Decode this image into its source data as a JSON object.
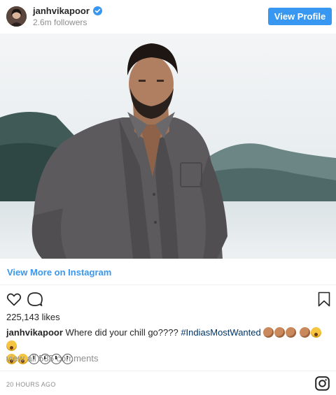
{
  "header": {
    "username": "janhvikapoor",
    "followers": "2.6m followers",
    "view_profile_label": "View Profile",
    "verified": true
  },
  "post": {
    "image_subject": "man-in-grey-shirt-by-lake",
    "view_more_label": "View More on Instagram",
    "likes": "225,143 likes",
    "caption_user": "janhvikapoor",
    "caption_text": "Where did your chill go????",
    "hashtag": "#IndiasMostWanted",
    "view_comments": "view all 535 comments",
    "timestamp": "20 HOURS AGO"
  },
  "colors": {
    "accent": "#3897f0",
    "hashtag": "#003569",
    "muted": "#8e8e8e"
  }
}
